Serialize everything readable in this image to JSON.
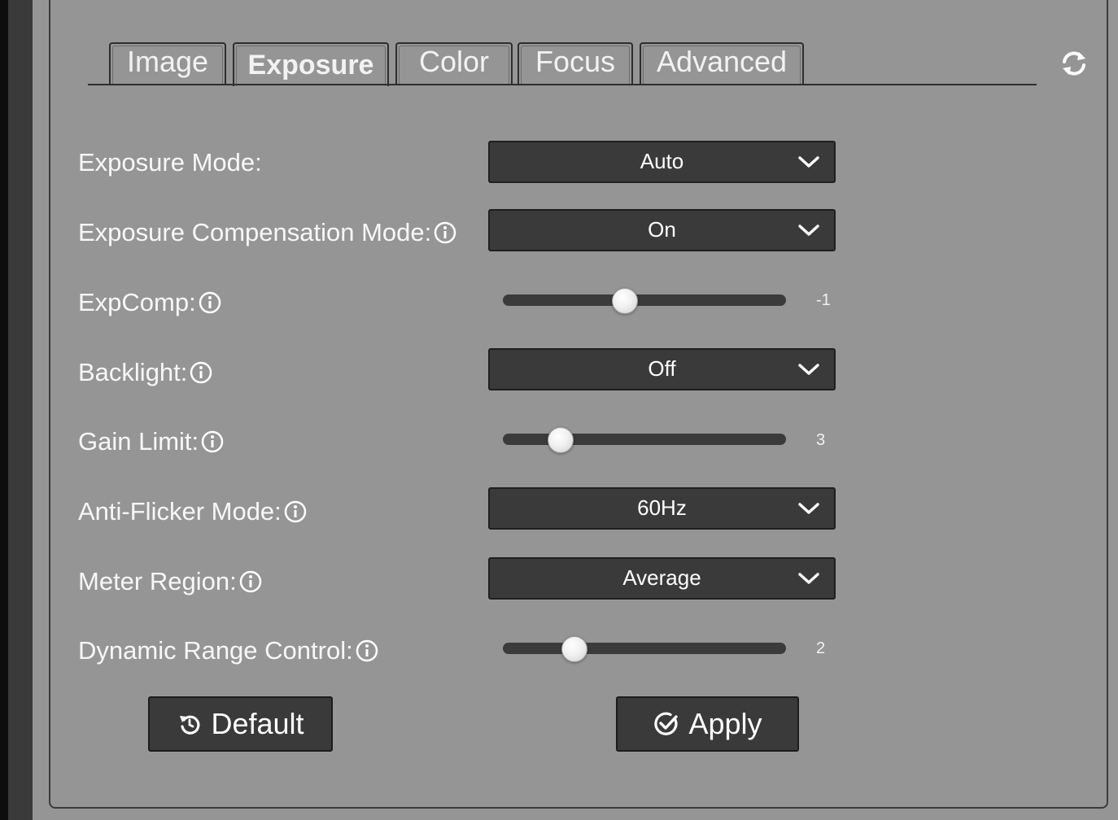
{
  "tabs": [
    {
      "label": "Image",
      "active": false
    },
    {
      "label": "Exposure",
      "active": true
    },
    {
      "label": "Color",
      "active": false
    },
    {
      "label": "Focus",
      "active": false
    },
    {
      "label": "Advanced",
      "active": false
    }
  ],
  "header": {
    "refresh_icon": "refresh-icon"
  },
  "fields": {
    "exposure_mode": {
      "label": "Exposure Mode:",
      "value": "Auto"
    },
    "exposure_compensation_mode": {
      "label": "Exposure Compensation Mode:",
      "value": "On",
      "info_icon": "info-icon"
    },
    "expcomp": {
      "label": "ExpComp:",
      "value": "-1",
      "min": -7,
      "max": 7,
      "info_icon": "info-icon"
    },
    "backlight": {
      "label": "Backlight:",
      "value": "Off",
      "info_icon": "info-icon"
    },
    "gain_limit": {
      "label": "Gain Limit:",
      "value": "3",
      "min": 0,
      "max": 15,
      "info_icon": "info-icon"
    },
    "anti_flicker_mode": {
      "label": "Anti-Flicker Mode:",
      "value": "60Hz",
      "info_icon": "info-icon"
    },
    "meter_region": {
      "label": "Meter Region:",
      "value": "Average",
      "info_icon": "info-icon"
    },
    "dynamic_range_control": {
      "label": "Dynamic Range Control:",
      "value": "2",
      "min": 0,
      "max": 8,
      "info_icon": "info-icon"
    }
  },
  "buttons": {
    "default_label": "Default",
    "apply_label": "Apply"
  },
  "colors": {
    "panel_bg": "#959595",
    "control_bg": "#3a3a3a",
    "text": "#f7f7f7"
  }
}
